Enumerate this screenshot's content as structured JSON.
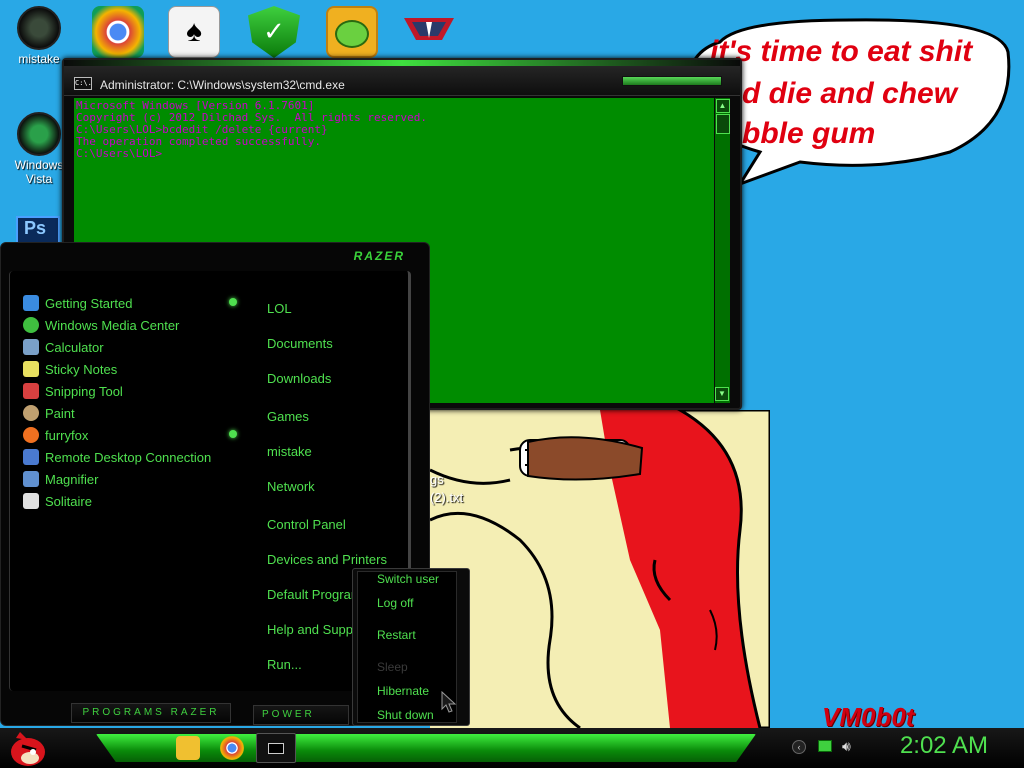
{
  "desktop": {
    "icons": [
      {
        "label": "mistake"
      },
      {
        "label": "Windows Vista"
      }
    ],
    "bubble_lines": [
      "it's time to eat shit",
      "d die and chew",
      "bble gum"
    ],
    "cartoon_file_label": "(2).txt",
    "cartoon_file_label2": "gs",
    "watermark": "VM0b0t"
  },
  "cmd": {
    "title": "Administrator: C:\\Windows\\system32\\cmd.exe",
    "icon_text": "C:\\.",
    "lines": [
      "Microsoft Windows [Version 6.1.7601]",
      "Copyright (c) 2012 Dilchad Sys.  All rights reserved.",
      "",
      "C:\\Users\\LOL>bcdedit /delete {current}",
      "The operation completed successfully.",
      "",
      "C:\\Users\\LOL>"
    ]
  },
  "start_menu": {
    "brand": "RAZER",
    "programs": [
      {
        "label": "Getting Started",
        "color": "#3a8be0"
      },
      {
        "label": "Windows Media Center",
        "color": "#3fbf3f"
      },
      {
        "label": "Calculator",
        "color": "#7aa0c8"
      },
      {
        "label": "Sticky Notes",
        "color": "#e8e060"
      },
      {
        "label": "Snipping Tool",
        "color": "#d84040"
      },
      {
        "label": "Paint",
        "color": "#c0a070"
      },
      {
        "label": "furryfox",
        "color": "#f07020"
      },
      {
        "label": "Remote Desktop Connection",
        "color": "#4a7ad0"
      },
      {
        "label": "Magnifier",
        "color": "#6090d0"
      },
      {
        "label": "Solitaire",
        "color": "#e0e0e0"
      }
    ],
    "places": [
      "LOL",
      "Documents",
      "Downloads",
      "Games",
      "mistake",
      "Network",
      "Control Panel",
      "Devices and Printers",
      "Default Programs",
      "Help and Support",
      "Run..."
    ],
    "programs_button": "PROGRAMS  RAZER",
    "power_button": "POWER"
  },
  "power_menu": {
    "items": [
      "Switch user",
      "Log off",
      "Restart",
      "Sleep",
      "Hibernate",
      "Shut down"
    ]
  },
  "taskbar": {
    "clock": "2:02 AM"
  },
  "colors": {
    "accent": "#4fe04f",
    "desktop": "#29a8e6",
    "console": "#008c00",
    "console_text": "#c800c8"
  }
}
